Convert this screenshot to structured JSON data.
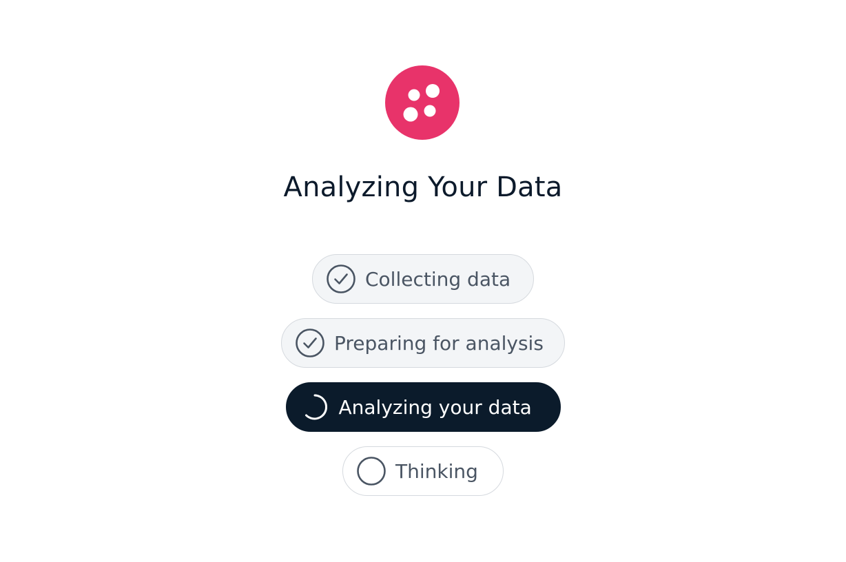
{
  "brand": {
    "logo_icon": "dots-logo-icon",
    "accent_color": "#e8336a"
  },
  "header": {
    "title": "Analyzing Your Data"
  },
  "steps": [
    {
      "label": "Collecting data",
      "status": "completed",
      "icon": "check-circle-icon"
    },
    {
      "label": "Preparing for analysis",
      "status": "completed",
      "icon": "check-circle-icon"
    },
    {
      "label": "Analyzing your data",
      "status": "in-progress",
      "icon": "spinner-icon"
    },
    {
      "label": "Thinking",
      "status": "pending",
      "icon": "empty-circle-icon"
    }
  ],
  "colors": {
    "active_background": "#0b1b2b",
    "done_background": "#f3f5f7",
    "text_muted": "#4a5563"
  }
}
